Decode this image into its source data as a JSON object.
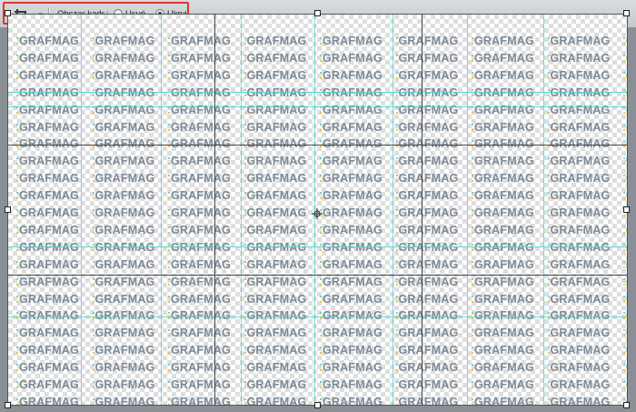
{
  "option_bar": {
    "crop_tool_icon": "crop-icon",
    "dropdown_icon": "chevron-down-icon",
    "area_label": "Obszar kadr.:",
    "radio_delete_label": "Usuń",
    "radio_hide_label": "Ukryj",
    "selected": "Ukryj",
    "highlight_color": "#e5332a"
  },
  "canvas": {
    "pattern_text": "GRAFMAG",
    "logo_accent_colors": [
      "#7fd3c2",
      "#f2c53d"
    ],
    "guide_color": "#47d5d0",
    "crop_overlay": "rule-of-thirds"
  }
}
